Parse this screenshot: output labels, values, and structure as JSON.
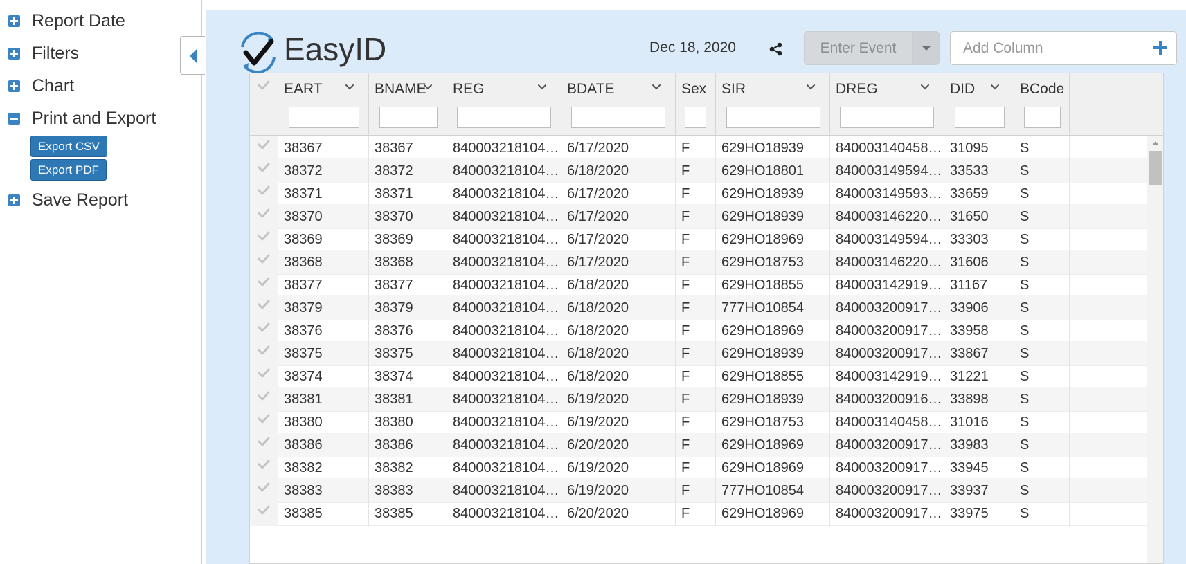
{
  "sidebar": {
    "items": [
      {
        "label": "Report Date",
        "expanded": false
      },
      {
        "label": "Filters",
        "expanded": false
      },
      {
        "label": "Chart",
        "expanded": false
      },
      {
        "label": "Print and Export",
        "expanded": true
      },
      {
        "label": "Save Report",
        "expanded": false
      }
    ],
    "export_csv": "Export CSV",
    "export_pdf": "Export PDF"
  },
  "header": {
    "brand": "EasyID",
    "date": "Dec 18, 2020",
    "event_button": "Enter Event",
    "add_column_placeholder": "Add Column"
  },
  "grid": {
    "columns": [
      "EART",
      "BNAME",
      "REG",
      "BDATE",
      "Sex",
      "SIR",
      "DREG",
      "DID",
      "BCode"
    ],
    "rows": [
      [
        "38367",
        "38367",
        "840003218104…",
        "6/17/2020",
        "F",
        "629HO18939",
        "840003140458…",
        "31095",
        "S"
      ],
      [
        "38372",
        "38372",
        "840003218104…",
        "6/18/2020",
        "F",
        "629HO18801",
        "840003149594…",
        "33533",
        "S"
      ],
      [
        "38371",
        "38371",
        "840003218104…",
        "6/17/2020",
        "F",
        "629HO18939",
        "840003149593…",
        "33659",
        "S"
      ],
      [
        "38370",
        "38370",
        "840003218104…",
        "6/17/2020",
        "F",
        "629HO18939",
        "840003146220…",
        "31650",
        "S"
      ],
      [
        "38369",
        "38369",
        "840003218104…",
        "6/17/2020",
        "F",
        "629HO18969",
        "840003149594…",
        "33303",
        "S"
      ],
      [
        "38368",
        "38368",
        "840003218104…",
        "6/17/2020",
        "F",
        "629HO18753",
        "840003146220…",
        "31606",
        "S"
      ],
      [
        "38377",
        "38377",
        "840003218104…",
        "6/18/2020",
        "F",
        "629HO18855",
        "840003142919…",
        "31167",
        "S"
      ],
      [
        "38379",
        "38379",
        "840003218104…",
        "6/18/2020",
        "F",
        "777HO10854",
        "840003200917…",
        "33906",
        "S"
      ],
      [
        "38376",
        "38376",
        "840003218104…",
        "6/18/2020",
        "F",
        "629HO18969",
        "840003200917…",
        "33958",
        "S"
      ],
      [
        "38375",
        "38375",
        "840003218104…",
        "6/18/2020",
        "F",
        "629HO18939",
        "840003200917…",
        "33867",
        "S"
      ],
      [
        "38374",
        "38374",
        "840003218104…",
        "6/18/2020",
        "F",
        "629HO18855",
        "840003142919…",
        "31221",
        "S"
      ],
      [
        "38381",
        "38381",
        "840003218104…",
        "6/19/2020",
        "F",
        "629HO18939",
        "840003200916…",
        "33898",
        "S"
      ],
      [
        "38380",
        "38380",
        "840003218104…",
        "6/19/2020",
        "F",
        "629HO18753",
        "840003140458…",
        "31016",
        "S"
      ],
      [
        "38386",
        "38386",
        "840003218104…",
        "6/20/2020",
        "F",
        "629HO18969",
        "840003200917…",
        "33983",
        "S"
      ],
      [
        "38382",
        "38382",
        "840003218104…",
        "6/19/2020",
        "F",
        "629HO18969",
        "840003200917…",
        "33945",
        "S"
      ],
      [
        "38383",
        "38383",
        "840003218104…",
        "6/19/2020",
        "F",
        "777HO10854",
        "840003200917…",
        "33937",
        "S"
      ],
      [
        "38385",
        "38385",
        "840003218104…",
        "6/20/2020",
        "F",
        "629HO18969",
        "840003200917…",
        "33975",
        "S"
      ]
    ]
  },
  "colors": {
    "accent": "#3a84c4",
    "button": "#2e78b5",
    "panel_bg": "#dcebf9"
  }
}
